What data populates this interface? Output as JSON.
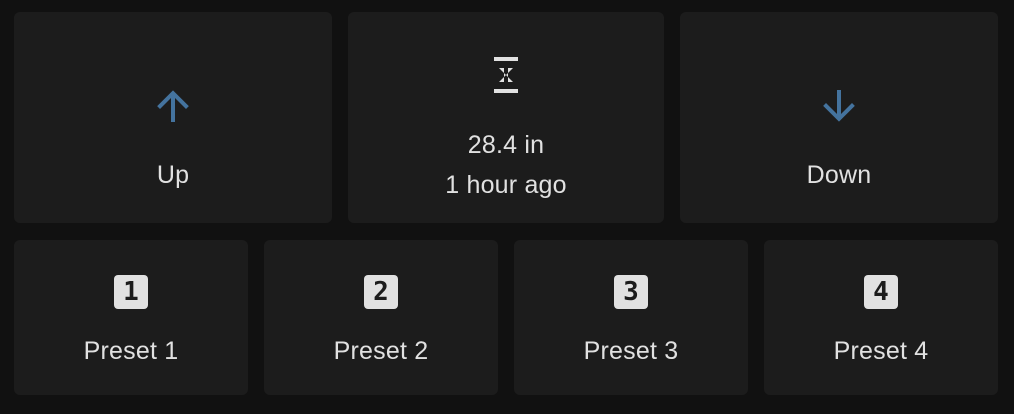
{
  "controls": {
    "up": {
      "label": "Up",
      "icon": "arrow-up-icon"
    },
    "height": {
      "value": "28.4 in",
      "updated": "1 hour ago",
      "icon": "arrow-expand-vertical-icon"
    },
    "down": {
      "label": "Down",
      "icon": "arrow-down-icon"
    }
  },
  "presets": [
    {
      "label": "Preset 1",
      "number": "1",
      "icon": "numeric-1-box-icon"
    },
    {
      "label": "Preset 2",
      "number": "2",
      "icon": "numeric-2-box-icon"
    },
    {
      "label": "Preset 3",
      "number": "3",
      "icon": "numeric-3-box-icon"
    },
    {
      "label": "Preset 4",
      "number": "4",
      "icon": "numeric-4-box-icon"
    }
  ],
  "colors": {
    "background": "#111111",
    "card": "#1c1c1c",
    "text": "#e1e1e1",
    "accent": "#44739e"
  }
}
